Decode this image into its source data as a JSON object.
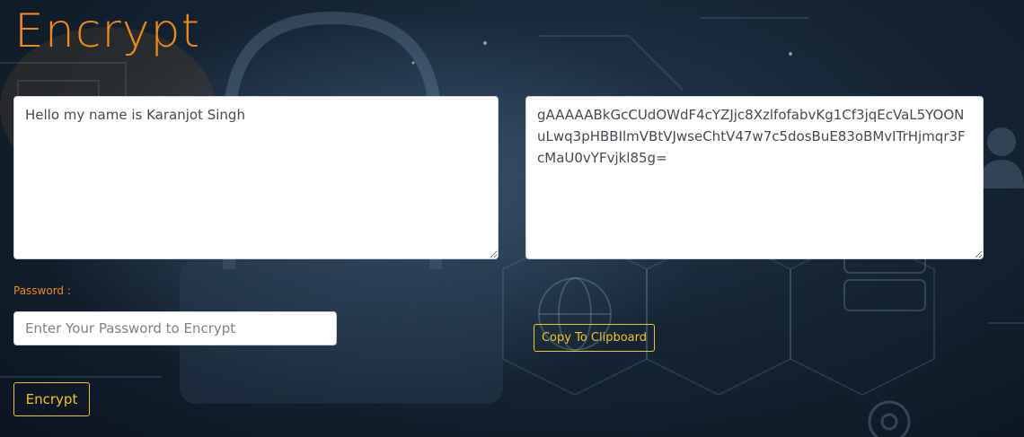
{
  "header": {
    "title": "Encrypt"
  },
  "plaintext": {
    "value": "Hello my name is Karanjot Singh"
  },
  "ciphertext": {
    "value": "gAAAAABkGcCUdOWdF4cYZJjc8XzlfofabvKg1Cf3jqEcVaL5YOONuLwq3pHBBIlmVBtVJwseChtV47w7c5dosBuE83oBMvITrHjmqr3FcMaU0vYFvjkl85g="
  },
  "password": {
    "label": "Password :",
    "placeholder": "Enter Your Password to Encrypt",
    "value": ""
  },
  "actions": {
    "copy_label": "Copy To Clipboard",
    "encrypt_label": "Encrypt"
  },
  "colors": {
    "accent_orange": "#f08a12",
    "button_yellow": "#f5c518",
    "background_dark": "#152536"
  },
  "background": {
    "description_icons": [
      "padlock-icon",
      "user-icon",
      "globe-icon",
      "gear-icon",
      "server-icon"
    ]
  }
}
